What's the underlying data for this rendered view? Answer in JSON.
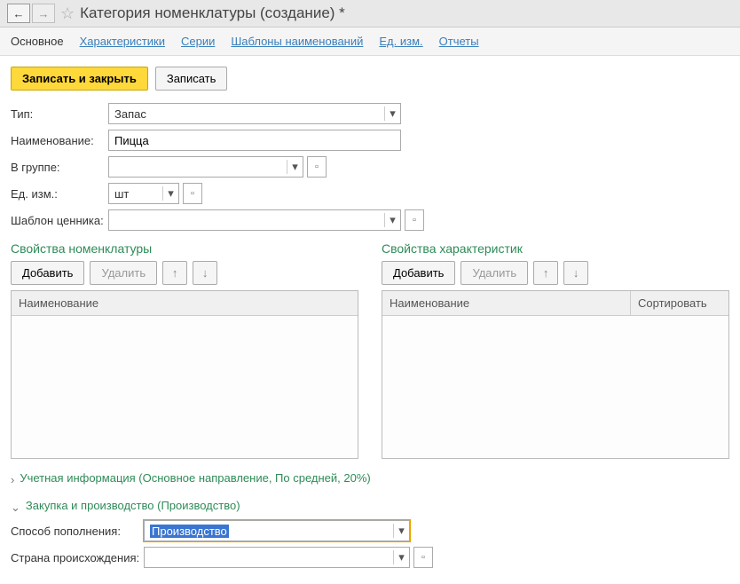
{
  "header": {
    "title": "Категория номенклатуры (создание) *"
  },
  "tabs": {
    "main": "Основное",
    "characteristics": "Характеристики",
    "series": "Серии",
    "name_templates": "Шаблоны наименований",
    "units": "Ед. изм.",
    "reports": "Отчеты"
  },
  "toolbar": {
    "save_close": "Записать и закрыть",
    "save": "Записать"
  },
  "form": {
    "type_label": "Тип:",
    "type_value": "Запас",
    "name_label": "Наименование:",
    "name_value": "Пицца",
    "group_label": "В группе:",
    "group_value": "",
    "unit_label": "Ед. изм.:",
    "unit_value": "шт",
    "price_template_label": "Шаблон ценника:",
    "price_template_value": ""
  },
  "props_nomenclature": {
    "title": "Свойства номенклатуры",
    "add": "Добавить",
    "delete": "Удалить",
    "col_name": "Наименование"
  },
  "props_characteristics": {
    "title": "Свойства характеристик",
    "add": "Добавить",
    "delete": "Удалить",
    "col_name": "Наименование",
    "col_sort": "Сортировать"
  },
  "accounting": {
    "title": "Учетная информация (Основное направление, По средней, 20%)"
  },
  "purchase": {
    "title": "Закупка и производство (Производство)",
    "replenish_label": "Способ пополнения:",
    "replenish_value": "Производство",
    "country_label": "Страна происхождения:",
    "country_value": ""
  }
}
